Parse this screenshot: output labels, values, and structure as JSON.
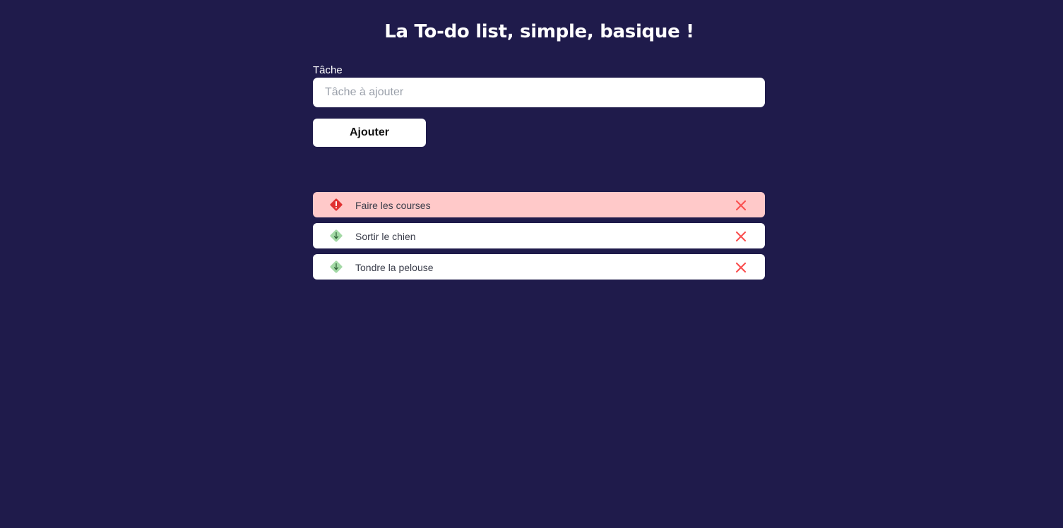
{
  "header": {
    "title": "La To-do list, simple, basique !"
  },
  "form": {
    "label": "Tâche",
    "input_placeholder": "Tâche à ajouter",
    "input_value": "",
    "add_button_label": "Ajouter"
  },
  "tasks": [
    {
      "text": "Faire les courses",
      "priority": "high",
      "icon": "alert-diamond-icon",
      "delete_icon": "close-icon"
    },
    {
      "text": "Sortir le chien",
      "priority": "low",
      "icon": "arrow-down-diamond-icon",
      "delete_icon": "close-icon"
    },
    {
      "text": "Tondre la pelouse",
      "priority": "low",
      "icon": "arrow-down-diamond-icon",
      "delete_icon": "close-icon"
    }
  ],
  "colors": {
    "background": "#1f1b4b",
    "high_priority_row": "#ffc9c9",
    "high_priority_icon": "#e03131",
    "low_priority_icon": "#a3d9a5",
    "delete_icon": "#fa5252"
  }
}
